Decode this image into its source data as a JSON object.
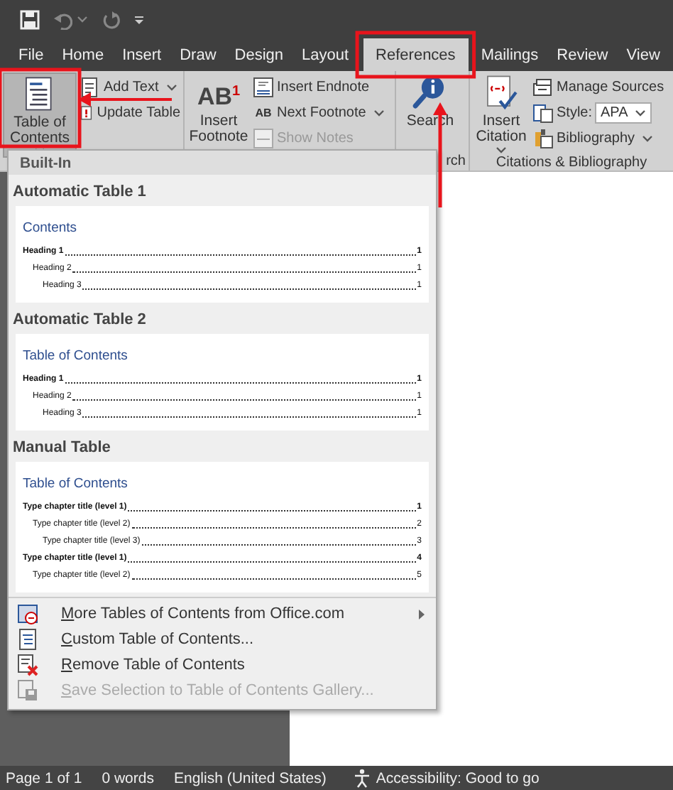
{
  "tabs": [
    {
      "label": "File",
      "selected": false
    },
    {
      "label": "Home",
      "selected": false
    },
    {
      "label": "Insert",
      "selected": false
    },
    {
      "label": "Draw",
      "selected": false
    },
    {
      "label": "Design",
      "selected": false
    },
    {
      "label": "Layout",
      "selected": false
    },
    {
      "label": "References",
      "selected": true
    },
    {
      "label": "Mailings",
      "selected": false
    },
    {
      "label": "Review",
      "selected": false
    },
    {
      "label": "View",
      "selected": false
    }
  ],
  "ribbon": {
    "groups": [
      {
        "items": [
          {
            "kind": "large",
            "label": "Table of Contents",
            "dropdown": true,
            "pressed": true
          },
          {
            "kind": "small",
            "label": "Add Text",
            "dropdown": true,
            "disabled": false
          },
          {
            "kind": "small",
            "label": "Update Table",
            "dropdown": false,
            "disabled": false
          }
        ]
      },
      {
        "items": [
          {
            "kind": "large",
            "label": "Insert Footnote",
            "glyph": "AB$^{1}$",
            "dropdown": false,
            "pressed": false
          },
          {
            "kind": "small",
            "label": "Insert Endnote",
            "dropdown": false,
            "disabled": false
          },
          {
            "kind": "small",
            "label": "Next Footnote",
            "glyph": "AB",
            "dropdown": true,
            "disabled": false
          },
          {
            "kind": "small",
            "label": "Show Notes",
            "dropdown": false,
            "disabled": true
          }
        ]
      },
      {
        "label": "rch",
        "items": [
          {
            "kind": "large",
            "label": "Search",
            "dropdown": false,
            "pressed": false
          }
        ]
      },
      {
        "label": "Citations & Bibliography",
        "items": [
          {
            "kind": "large",
            "label": "Insert Citation",
            "dropdown": true,
            "pressed": false
          },
          {
            "kind": "small",
            "label": "Manage Sources",
            "dropdown": false,
            "disabled": false
          },
          {
            "kind": "combo",
            "label": "Style:",
            "value": "APA"
          },
          {
            "kind": "small",
            "label": "Bibliography",
            "dropdown": true,
            "disabled": false
          }
        ]
      }
    ]
  },
  "menu": {
    "header": "Built-In",
    "gallery": [
      {
        "title": "Automatic Table 1",
        "preview": {
          "heading": "Contents",
          "entries": [
            {
              "text": "Heading 1",
              "page": "1",
              "children": [
                {
                  "text": "Heading 2",
                  "page": "1",
                  "children": [
                    {
                      "text": "Heading 3",
                      "page": "1"
                    }
                  ]
                }
              ]
            }
          ]
        }
      },
      {
        "title": "Automatic Table 2",
        "preview": {
          "heading": "Table of Contents",
          "entries": [
            {
              "text": "Heading 1",
              "page": "1",
              "children": [
                {
                  "text": "Heading 2",
                  "page": "1",
                  "children": [
                    {
                      "text": "Heading 3",
                      "page": "1"
                    }
                  ]
                }
              ]
            }
          ]
        }
      },
      {
        "title": "Manual Table",
        "preview": {
          "heading": "Table of Contents",
          "entries": [
            {
              "text": "Type chapter title (level 1)",
              "page": "1",
              "children": [
                {
                  "text": "Type chapter title (level 2)",
                  "page": "2",
                  "children": [
                    {
                      "text": "Type chapter title (level 3)",
                      "page": "3"
                    }
                  ]
                }
              ]
            },
            {
              "text": "Type chapter title (level 1)",
              "page": "4",
              "children": [
                {
                  "text": "Type chapter title (level 2)",
                  "page": "5"
                }
              ]
            }
          ]
        }
      }
    ],
    "commands": [
      {
        "label": "More Tables of Contents from Office.com",
        "submenu": true,
        "disabled": false
      },
      {
        "label": "Custom Table of Contents...",
        "submenu": false,
        "disabled": false
      },
      {
        "label": "Remove Table of Contents",
        "submenu": false,
        "disabled": false
      },
      {
        "label": "Save Selection to Table of Contents Gallery...",
        "submenu": false,
        "disabled": true
      }
    ]
  },
  "status_bar": {
    "items": [
      {
        "kind": "text",
        "label": "Page 1 of 1"
      },
      {
        "kind": "text",
        "label": "0 words"
      },
      {
        "kind": "text",
        "label": "English (United States)"
      },
      {
        "kind": "accessibility",
        "label": "Accessibility: Good to go"
      }
    ]
  }
}
